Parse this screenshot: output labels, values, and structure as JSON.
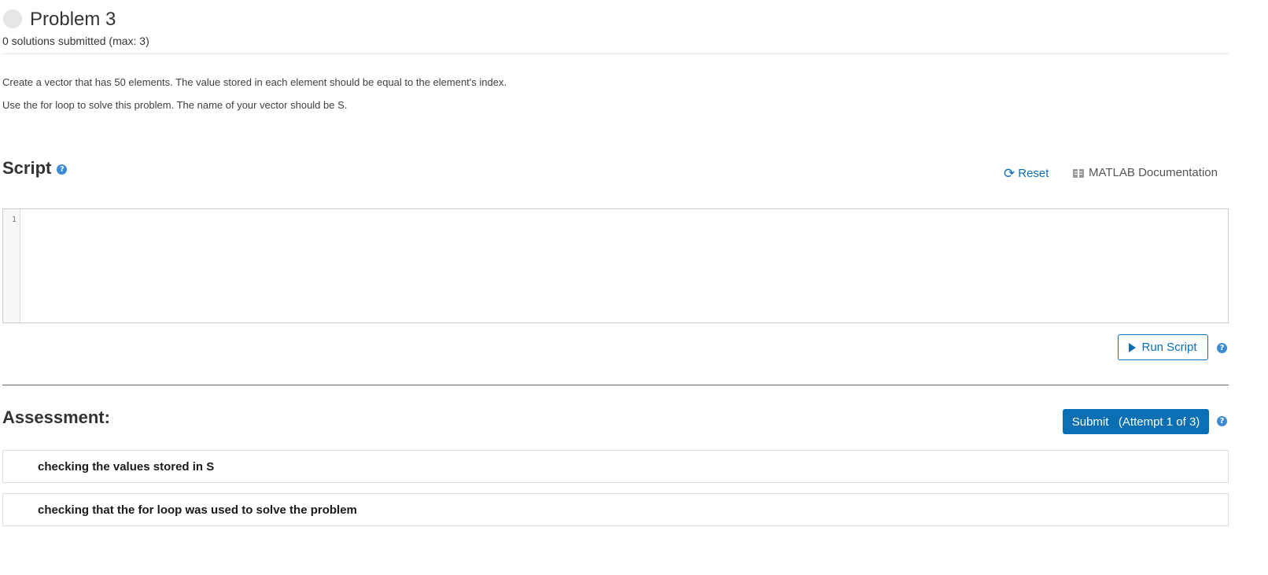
{
  "problem": {
    "title": "Problem 3",
    "submitted_count": "0 solutions submitted (max: 3)",
    "description": [
      "Create a vector that has 50 elements. The value stored in each element should be equal to the element's index.",
      "Use the for loop to solve this problem. The name of your vector should be S."
    ]
  },
  "script": {
    "heading": "Script",
    "help_icon": "question-circle-icon",
    "reset_label": "Reset",
    "reset_icon": "refresh-icon",
    "doc_label": "MATLAB Documentation",
    "doc_icon": "book-icon",
    "editor": {
      "line_numbers": [
        "1"
      ],
      "code": ""
    },
    "run_label": "Run Script",
    "run_icon": "play-icon"
  },
  "assessment": {
    "heading": "Assessment:",
    "submit_label": "Submit   (Attempt 1 of 3)",
    "tests": [
      {
        "label": "checking the values stored in S"
      },
      {
        "label": "checking that the for loop was used to solve the problem"
      }
    ]
  },
  "colors": {
    "accent": "#0b6fb3",
    "help_icon": "#3d8bd2",
    "status_circle": "#e5e5e5"
  }
}
